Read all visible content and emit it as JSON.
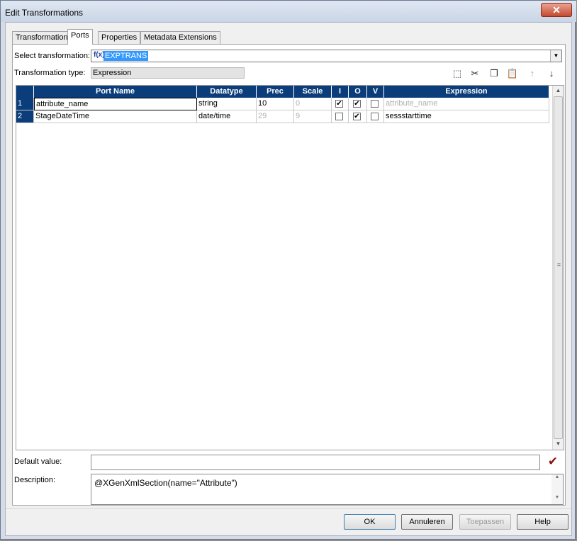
{
  "window": {
    "title": "Edit Transformations",
    "close_glyph": "✕"
  },
  "tabs": [
    {
      "label": "Transformation"
    },
    {
      "label": "Ports",
      "active": true
    },
    {
      "label": "Properties"
    },
    {
      "label": "Metadata Extensions"
    }
  ],
  "select_transformation": {
    "label": "Select transformation:",
    "icon_glyph": "f(x)",
    "value": "EXPTRANS"
  },
  "transformation_type": {
    "label": "Transformation type:",
    "value": "Expression"
  },
  "toolbar": {
    "icons": [
      "new-port-icon",
      "cut-icon",
      "copy-icon",
      "paste-icon",
      "move-up-icon",
      "move-down-icon"
    ]
  },
  "ports_table": {
    "columns": [
      "",
      "Port Name",
      "Datatype",
      "Prec",
      "Scale",
      "I",
      "O",
      "V",
      "Expression"
    ],
    "rows": [
      {
        "num": "1",
        "name": "attribute_name",
        "datatype": "string",
        "prec": "10",
        "scale": "0",
        "i": true,
        "o": true,
        "v": false,
        "expression": "attribute_name"
      },
      {
        "num": "2",
        "name": "StageDateTime",
        "datatype": "date/time",
        "prec": "29",
        "scale": "9",
        "i": false,
        "o": true,
        "v": false,
        "expression": "sessstarttime"
      }
    ]
  },
  "default_value": {
    "label": "Default value:",
    "value": ""
  },
  "description": {
    "label": "Description:",
    "value": "@XGenXmlSection(name=\"Attribute\")"
  },
  "buttons": {
    "ok": "OK",
    "cancel": "Annuleren",
    "apply": "Toepassen",
    "help": "Help"
  },
  "colors": {
    "header_bg": "#0a3d7a",
    "selection": "#3399ff",
    "validate_mark": "#8b1010"
  }
}
